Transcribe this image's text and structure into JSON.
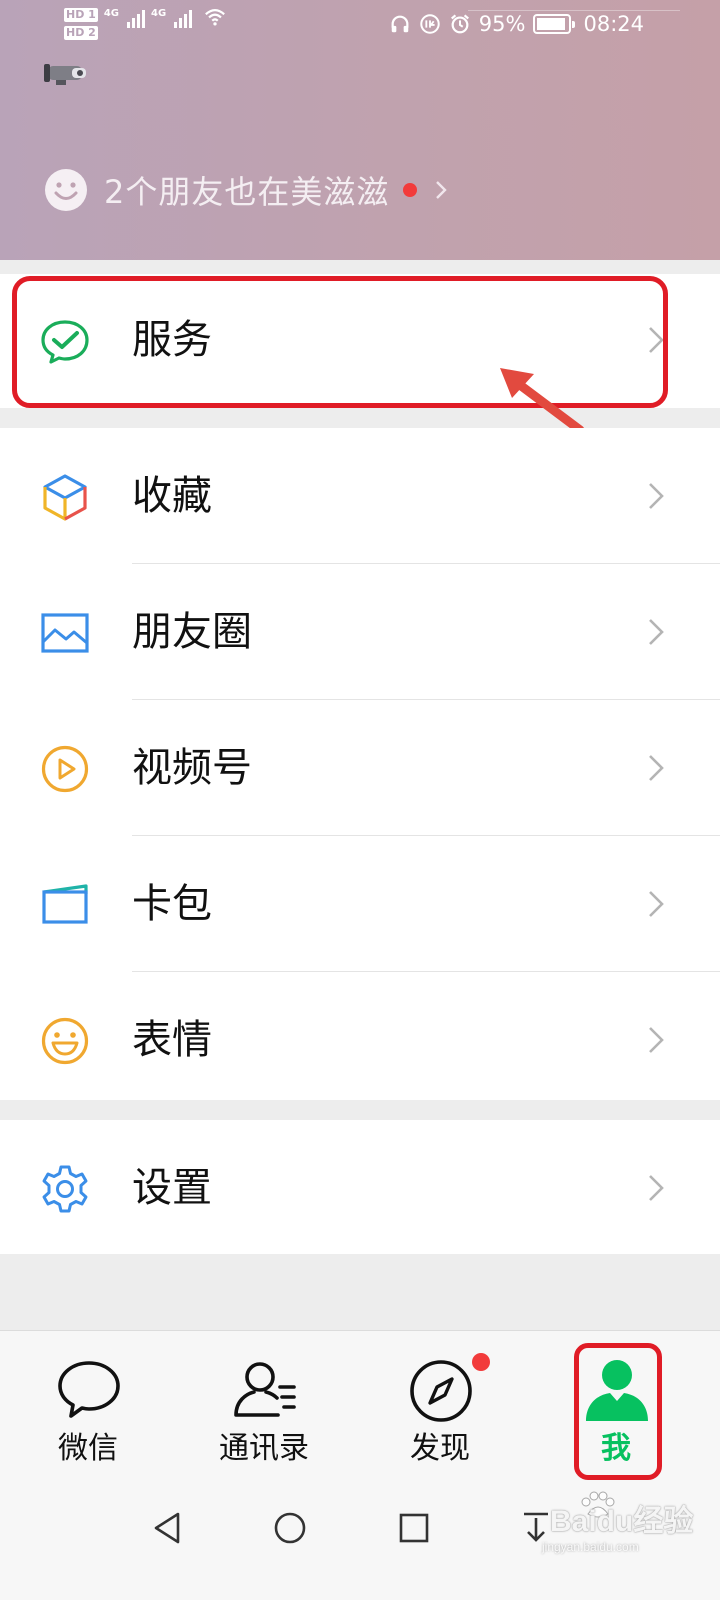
{
  "status_bar": {
    "hd1": "HD 1",
    "hd2": "HD 2",
    "sig1": "4G",
    "sig2": "4G",
    "battery": "95%",
    "time": "08:24"
  },
  "header": {
    "friends_text": "2个朋友也在美滋滋"
  },
  "menu": {
    "services": "服务",
    "favorites": "收藏",
    "moments": "朋友圈",
    "channels": "视频号",
    "card_wallet": "卡包",
    "stickers": "表情",
    "settings": "设置"
  },
  "tabs": {
    "chats": "微信",
    "contacts": "通讯录",
    "discover": "发现",
    "me": "我"
  },
  "watermark": {
    "main": "Baidu经验",
    "sub": "jingyan.baidu.com"
  },
  "colors": {
    "accent_green": "#07c160",
    "annotation_red": "#e01c26",
    "badge_red": "#f23b3b"
  }
}
